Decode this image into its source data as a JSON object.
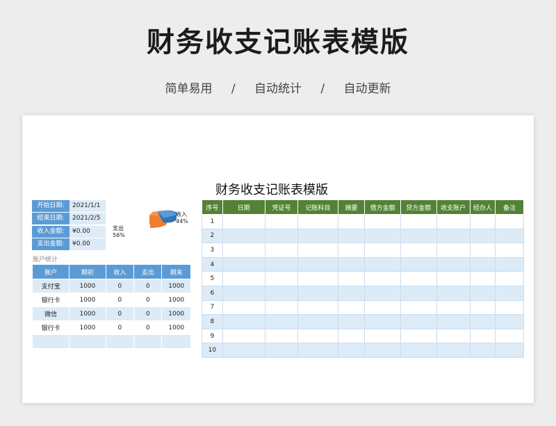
{
  "hero": {
    "title": "财务收支记账表模版",
    "features": [
      "简单易用",
      "/",
      "自动统计",
      "/",
      "自动更新"
    ]
  },
  "sheet": {
    "title": "财务收支记账表模版",
    "summary": [
      {
        "label": "开始日期:",
        "value": "2021/1/1"
      },
      {
        "label": "结束日期:",
        "value": "2021/2/5"
      },
      {
        "label": "收入金额:",
        "value": "¥0.00"
      },
      {
        "label": "支出金额:",
        "value": "¥0.00"
      }
    ],
    "pie": {
      "income_label": "收入",
      "income_pct": "44%",
      "expense_label": "支出",
      "expense_pct": "56%",
      "income_color": "#5b9bd5",
      "expense_color": "#ed7d31"
    },
    "accounts": {
      "title": "账户统计",
      "headers": [
        "账户",
        "期初",
        "收入",
        "支出",
        "期末"
      ],
      "rows": [
        [
          "支付宝",
          "1000",
          "0",
          "0",
          "1000"
        ],
        [
          "银行卡",
          "1000",
          "0",
          "0",
          "1000"
        ],
        [
          "微信",
          "1000",
          "0",
          "0",
          "1000"
        ],
        [
          "银行卡",
          "1000",
          "0",
          "0",
          "1000"
        ],
        [
          "",
          "",
          "",
          "",
          ""
        ]
      ]
    },
    "ledger": {
      "headers": [
        "序号",
        "日期",
        "凭证号",
        "记账科目",
        "摘要",
        "借方金额",
        "贷方金额",
        "收支账户",
        "经办人",
        "备注"
      ],
      "row_numbers": [
        "1",
        "2",
        "3",
        "4",
        "5",
        "6",
        "7",
        "8",
        "9",
        "10"
      ]
    }
  }
}
